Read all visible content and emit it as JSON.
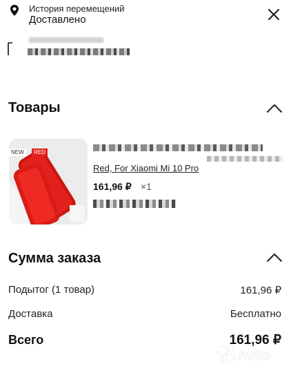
{
  "tracking": {
    "subtitle": "История перемещений",
    "status": "Доставлено"
  },
  "service": {
    "label": "Служба доставки",
    "value": "******************"
  },
  "products": {
    "title": "Товары",
    "item": {
      "image_tag_new": "NEW",
      "image_tag_red": "RED",
      "name": "Red, For Xiaomi Mi 10 Pro",
      "price": "161,96 ₽",
      "quantity": "×1"
    }
  },
  "summary": {
    "title": "Сумма заказа",
    "subtotal_label": "Подытог (1 товар)",
    "subtotal_value": "161,96 ₽",
    "delivery_label": "Доставка",
    "delivery_value": "Бесплатно",
    "total_label": "Всего",
    "total_value": "161,96 ₽"
  },
  "watermark": {
    "text": "Avito"
  },
  "colors": {
    "accent_red": "#e3211c",
    "text": "#111111"
  }
}
